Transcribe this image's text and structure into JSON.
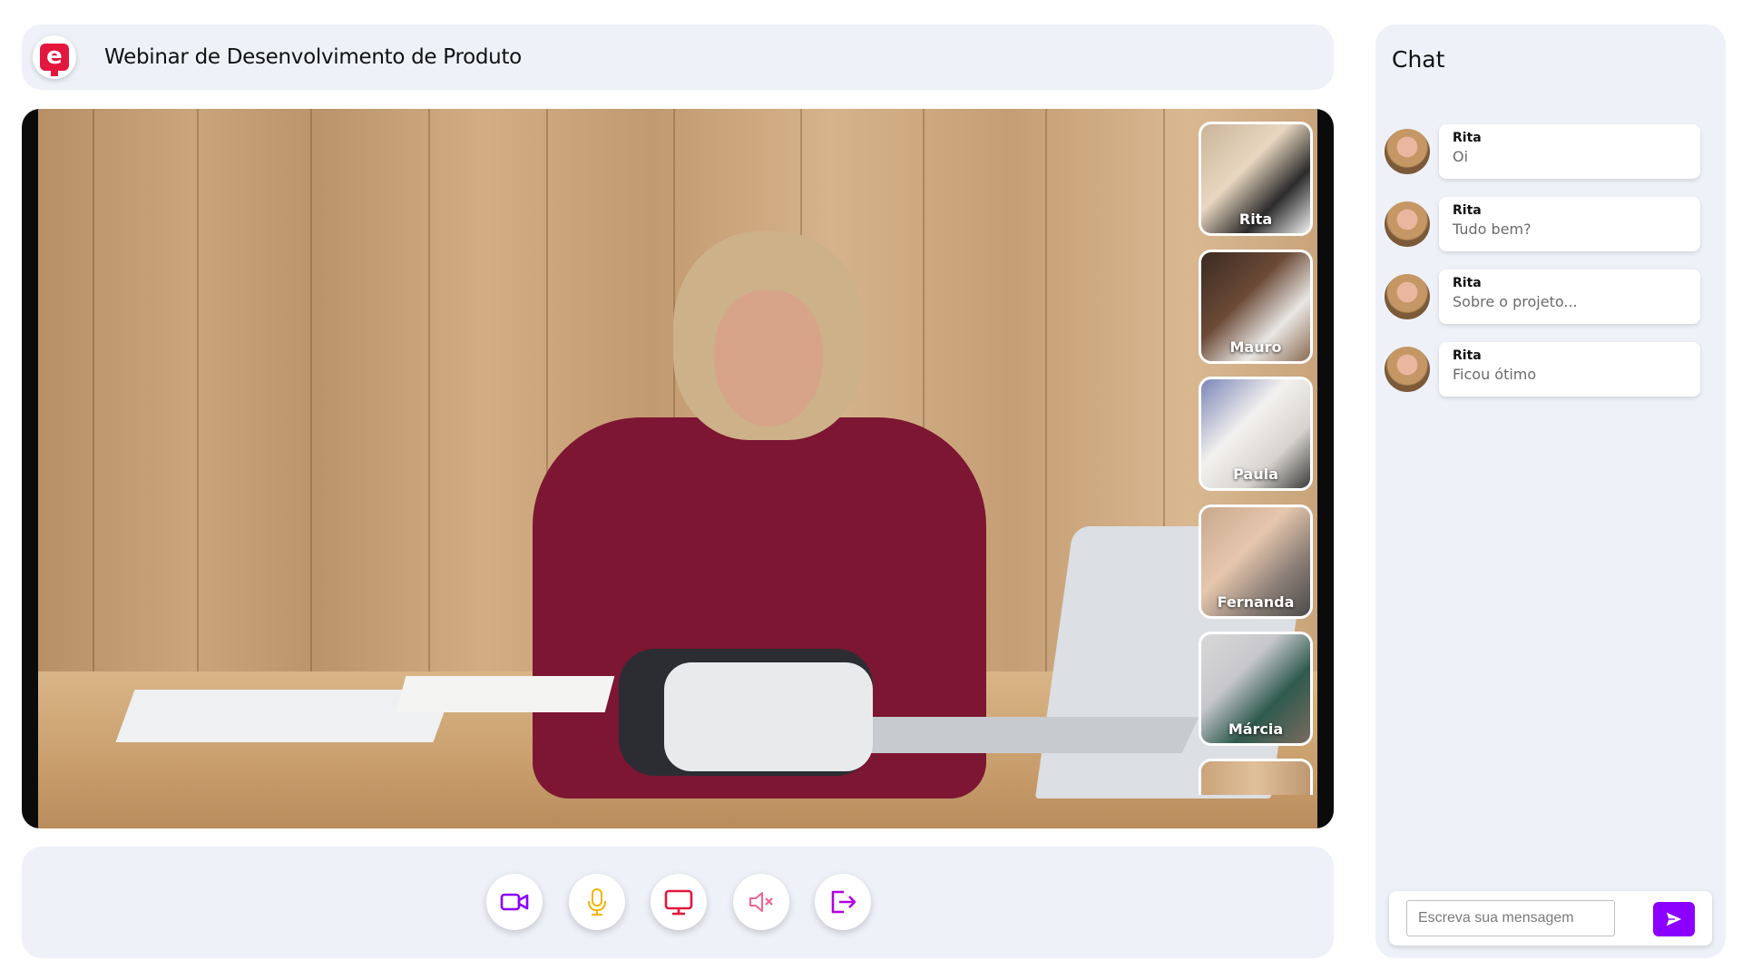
{
  "header": {
    "title": "Webinar de Desenvolvimento de Produto",
    "logo_icon": "e-logo-icon",
    "brand_color": "#e3173e"
  },
  "participants": [
    {
      "name": "Rita"
    },
    {
      "name": "Mauro"
    },
    {
      "name": "Paula"
    },
    {
      "name": "Fernanda"
    },
    {
      "name": "Márcia"
    },
    {
      "name": ""
    }
  ],
  "controls": [
    {
      "icon": "video-camera-icon",
      "color": "#8b00ff"
    },
    {
      "icon": "microphone-icon",
      "color": "#f5b400"
    },
    {
      "icon": "screen-share-icon",
      "color": "#e3173e"
    },
    {
      "icon": "speaker-muted-icon",
      "color": "#f06292"
    },
    {
      "icon": "leave-icon",
      "color": "#b000e0"
    }
  ],
  "chat": {
    "title": "Chat",
    "messages": [
      {
        "author": "Rita",
        "text": "Oi"
      },
      {
        "author": "Rita",
        "text": "Tudo bem?"
      },
      {
        "author": "Rita",
        "text": "Sobre o projeto..."
      },
      {
        "author": "Rita",
        "text": "Ficou ótimo"
      }
    ],
    "input_placeholder": "Escreva sua mensagem",
    "send_icon": "send-icon",
    "accent": "#8b00ff"
  }
}
